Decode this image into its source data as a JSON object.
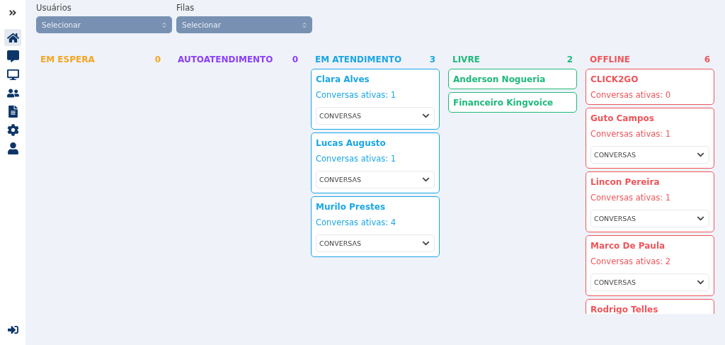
{
  "sidebar": {
    "items": [
      {
        "selected": true
      },
      {
        "selected": false
      },
      {
        "selected": false
      },
      {
        "selected": false
      },
      {
        "selected": false
      },
      {
        "selected": false
      },
      {
        "selected": false
      }
    ]
  },
  "filters": [
    {
      "label": "Usuários",
      "placeholder": "Selecionar"
    },
    {
      "label": "Filas",
      "placeholder": "Selecionar"
    }
  ],
  "columns": [
    {
      "title": "EM ESPERA",
      "count": "0",
      "color": "#f5a623"
    },
    {
      "title": "AUTOATENDIMENTO",
      "count": "0",
      "color": "#8a3ffc"
    },
    {
      "title": "EM ATENDIMENTO",
      "count": "3",
      "color": "#1aa6e6",
      "cards": [
        {
          "name": "Clara Alves",
          "active": "Conversas ativas: 1",
          "menu": "CONVERSAS"
        },
        {
          "name": "Lucas Augusto",
          "active": "Conversas ativas: 1",
          "menu": "CONVERSAS"
        },
        {
          "name": "Murilo Prestes",
          "active": "Conversas ativas: 4",
          "menu": "CONVERSAS"
        }
      ]
    },
    {
      "title": "LIVRE",
      "count": "2",
      "color": "#1db97a",
      "cards": [
        {
          "name": "Anderson Nogueria"
        },
        {
          "name": "Financeiro Kingvoice"
        }
      ]
    },
    {
      "title": "OFFLINE",
      "count": "6",
      "color": "#f0555a",
      "cards": [
        {
          "name": "CLICK2GO",
          "active": "Conversas ativas: 0"
        },
        {
          "name": "Guto Campos",
          "active": "Conversas ativas: 1",
          "menu": "CONVERSAS"
        },
        {
          "name": "Lincon Pereira",
          "active": "Conversas ativas: 1",
          "menu": "CONVERSAS"
        },
        {
          "name": "Marco De Paula",
          "active": "Conversas ativas: 2",
          "menu": "CONVERSAS"
        },
        {
          "name": "Rodrigo Telles"
        }
      ]
    }
  ]
}
